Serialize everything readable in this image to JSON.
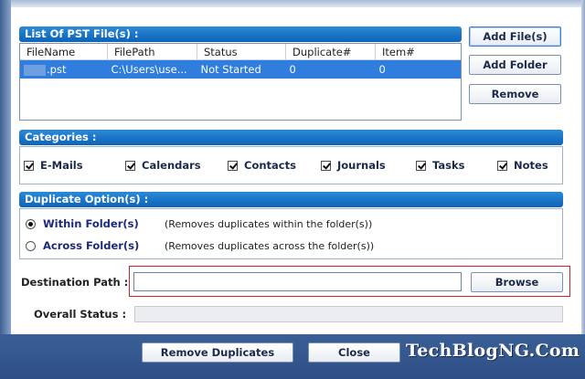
{
  "pst_list": {
    "header": "List Of PST File(s) :",
    "columns": [
      "FileName",
      "FilePath",
      "Status",
      "Duplicate#",
      "Item#"
    ],
    "rows": [
      {
        "filename": ".pst",
        "filepath": "C:\\Users\\use...",
        "status": "Not Started",
        "duplicate": "0",
        "item": "0"
      }
    ]
  },
  "file_buttons": {
    "add_files": "Add File(s)",
    "add_folder": "Add Folder",
    "remove": "Remove"
  },
  "categories": {
    "header": "Categories :",
    "items": [
      "E-Mails",
      "Calendars",
      "Contacts",
      "Journals",
      "Tasks",
      "Notes"
    ]
  },
  "duplicate_options": {
    "header": "Duplicate Option(s) :",
    "options": [
      {
        "label": "Within Folder(s)",
        "description": "(Removes duplicates within the folder(s))",
        "selected": true
      },
      {
        "label": "Across Folder(s)",
        "description": "(Removes duplicates across the folder(s))",
        "selected": false
      }
    ]
  },
  "destination": {
    "label": "Destination Path :",
    "value": "",
    "browse": "Browse",
    "highlight_color": "#d0202a"
  },
  "status": {
    "label": "Overall Status :",
    "progress": 0
  },
  "footer": {
    "remove_duplicates": "Remove Duplicates",
    "close": "Close",
    "watermark": "TechBlogNG.Com"
  }
}
